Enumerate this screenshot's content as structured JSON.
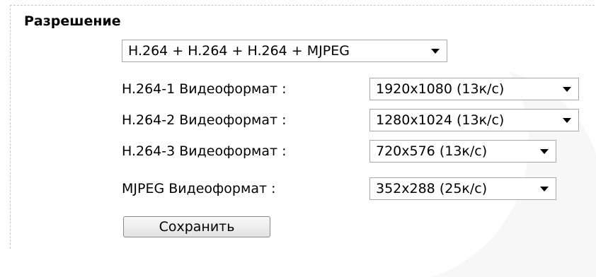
{
  "section": {
    "title": "Разрешение"
  },
  "stream_mode": {
    "selected": "H.264 + H.264 + H.264 + MJPEG"
  },
  "video_formats": [
    {
      "label": "H.264-1 Видеоформат :",
      "selected": "1920x1080 (13к/с)"
    },
    {
      "label": "H.264-2 Видеоформат :",
      "selected": "1280x1024 (13к/с)"
    },
    {
      "label": "H.264-3 Видеоформат :",
      "selected": "720x576 (13к/с)"
    },
    {
      "label": "MJPEG Видеоформат :",
      "selected": "352x288 (25к/с)"
    }
  ],
  "actions": {
    "save_label": "Сохранить"
  },
  "icons": {
    "dropdown": "chevron-down-icon",
    "watermark": "watermark-logo"
  },
  "colors": {
    "border": "#a7a7a7",
    "panel_border": "#c8c8c8",
    "button_bg": "#e8e8e8"
  }
}
